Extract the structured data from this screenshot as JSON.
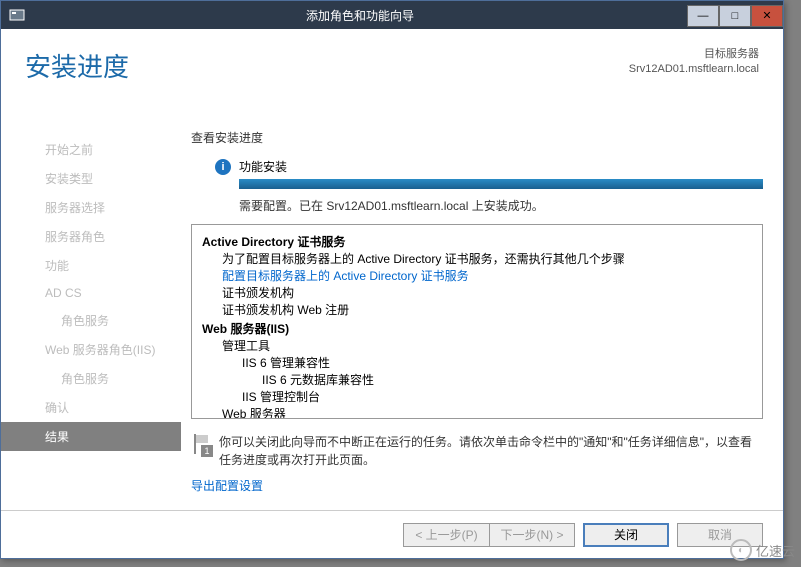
{
  "window": {
    "title": "添加角色和功能向导"
  },
  "header": {
    "page_title": "安装进度",
    "target_label": "目标服务器",
    "target_value": "Srv12AD01.msftlearn.local"
  },
  "sidebar": {
    "items": [
      {
        "label": "开始之前",
        "active": false,
        "indent": false
      },
      {
        "label": "安装类型",
        "active": false,
        "indent": false
      },
      {
        "label": "服务器选择",
        "active": false,
        "indent": false
      },
      {
        "label": "服务器角色",
        "active": false,
        "indent": false
      },
      {
        "label": "功能",
        "active": false,
        "indent": false
      },
      {
        "label": "AD CS",
        "active": false,
        "indent": false
      },
      {
        "label": "角色服务",
        "active": false,
        "indent": true
      },
      {
        "label": "Web 服务器角色(IIS)",
        "active": false,
        "indent": false
      },
      {
        "label": "角色服务",
        "active": false,
        "indent": true
      },
      {
        "label": "确认",
        "active": false,
        "indent": false
      },
      {
        "label": "结果",
        "active": true,
        "indent": false
      }
    ]
  },
  "main": {
    "subheader": "查看安装进度",
    "status_label": "功能安装",
    "status_msg": "需要配置。已在 Srv12AD01.msftlearn.local 上安装成功。",
    "details": [
      {
        "text": "Active Directory 证书服务",
        "level": 0,
        "bold": true
      },
      {
        "text": "为了配置目标服务器上的 Active Directory 证书服务，还需执行其他几个步骤",
        "level": 1
      },
      {
        "text": "配置目标服务器上的 Active Directory 证书服务",
        "level": 1,
        "link": true
      },
      {
        "text": "证书颁发机构",
        "level": 1
      },
      {
        "text": "证书颁发机构 Web 注册",
        "level": 1
      },
      {
        "text": "Web 服务器(IIS)",
        "level": 0,
        "bold": true
      },
      {
        "text": "管理工具",
        "level": 1
      },
      {
        "text": "IIS 6 管理兼容性",
        "level": 2
      },
      {
        "text": "IIS 6 元数据库兼容性",
        "level": 3
      },
      {
        "text": "IIS 管理控制台",
        "level": 2
      },
      {
        "text": "Web 服务器",
        "level": 1
      }
    ],
    "note": "你可以关闭此向导而不中断正在运行的任务。请依次单击命令栏中的\"通知\"和\"任务详细信息\"，以查看任务进度或再次打开此页面。",
    "export_link": "导出配置设置",
    "notification_count": "1"
  },
  "footer": {
    "prev": "< 上一步(P)",
    "next": "下一步(N) >",
    "close": "关闭",
    "cancel": "取消"
  },
  "watermark": "亿速云"
}
